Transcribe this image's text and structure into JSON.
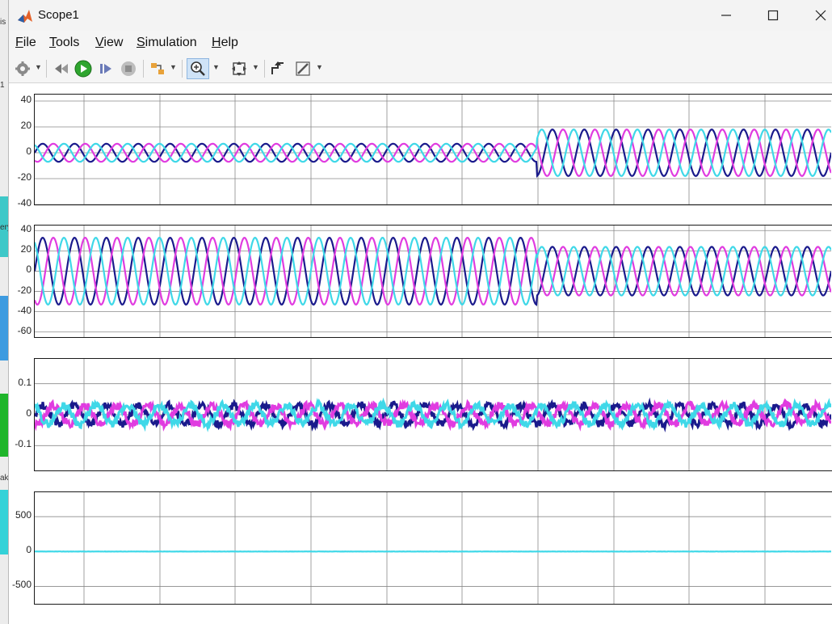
{
  "window": {
    "title": "Scope1"
  },
  "menu": {
    "file": "File",
    "tools": "Tools",
    "view": "View",
    "simulation": "Simulation",
    "help": "Help"
  },
  "toolbar_icons": [
    "gear-icon",
    "step-back-icon",
    "run-icon",
    "step-forward-icon",
    "stop-icon",
    "signal-selector-icon",
    "zoom-in-icon",
    "fit-to-view-icon",
    "triggers-icon",
    "cursor-measurements-icon"
  ],
  "colors": {
    "phase_a": "#1a1a8c",
    "phase_b": "#e03ce0",
    "phase_c": "#3fd8e8",
    "grid": "#8a8a8a"
  },
  "background_app": {
    "labels": [
      "is",
      "1",
      "ery",
      "ak"
    ]
  },
  "chart_data": [
    {
      "type": "line",
      "ylim": [
        -40,
        45
      ],
      "yticks": [
        "40",
        "20",
        "0",
        "-20",
        "-40"
      ],
      "grid": true,
      "series": [
        {
          "phase": "a",
          "amplitude_before": 7,
          "amplitude_after": 18
        },
        {
          "phase": "b",
          "amplitude_before": 7,
          "amplitude_after": 18
        },
        {
          "phase": "c",
          "amplitude_before": 7,
          "amplitude_after": 18
        }
      ],
      "step_fraction": 0.63,
      "cycles": 25
    },
    {
      "type": "line",
      "ylim": [
        -65,
        45
      ],
      "yticks": [
        "40",
        "20",
        "0",
        "-20",
        "-40",
        "-60"
      ],
      "grid": true,
      "series": [
        {
          "phase": "a",
          "amplitude_before": 33,
          "amplitude_after": 24
        },
        {
          "phase": "b",
          "amplitude_before": 33,
          "amplitude_after": 24
        },
        {
          "phase": "c",
          "amplitude_before": 33,
          "amplitude_after": 24
        }
      ],
      "step_fraction": 0.63,
      "cycles": 25
    },
    {
      "type": "line",
      "ylim": [
        -0.18,
        0.18
      ],
      "yticks": [
        "0.1",
        "0",
        "-0.1"
      ],
      "grid": true,
      "series": [
        {
          "phase": "a",
          "amplitude_before": 0.03,
          "amplitude_after": 0.03
        },
        {
          "phase": "b",
          "amplitude_before": 0.03,
          "amplitude_after": 0.03
        },
        {
          "phase": "c",
          "amplitude_before": 0.03,
          "amplitude_after": 0.03
        }
      ],
      "step_fraction": 0.63,
      "cycles": 25,
      "noise": 0.012
    },
    {
      "type": "line",
      "ylim": [
        -750,
        850
      ],
      "yticks": [
        "500",
        "0",
        "-500"
      ],
      "grid": true,
      "series": [
        {
          "phase": "single",
          "amplitude_before": 0,
          "amplitude_after": 0
        }
      ],
      "step_fraction": 0.63,
      "cycles": 25
    }
  ]
}
